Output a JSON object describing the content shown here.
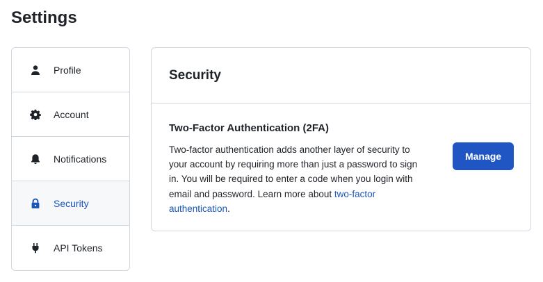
{
  "page": {
    "title": "Settings"
  },
  "sidebar": {
    "items": [
      {
        "label": "Profile",
        "icon": "person-icon",
        "active": false
      },
      {
        "label": "Account",
        "icon": "gear-icon",
        "active": false
      },
      {
        "label": "Notifications",
        "icon": "bell-icon",
        "active": false
      },
      {
        "label": "Security",
        "icon": "lock-icon",
        "active": true
      },
      {
        "label": "API Tokens",
        "icon": "plug-icon",
        "active": false
      }
    ]
  },
  "security": {
    "title": "Security",
    "twofa": {
      "title": "Two-Factor Authentication (2FA)",
      "description": "Two-factor authentication adds another layer of security to your account by requiring more than just a password to sign in. You will be required to enter a code when you login with email and password. Learn more about ",
      "link_text": "two-factor authentication",
      "trailing": ".",
      "button_label": "Manage"
    }
  },
  "colors": {
    "accent": "#1f56c4",
    "link": "#1a55b8",
    "border": "#d0d7de",
    "active_bg": "#f6f8fa"
  }
}
